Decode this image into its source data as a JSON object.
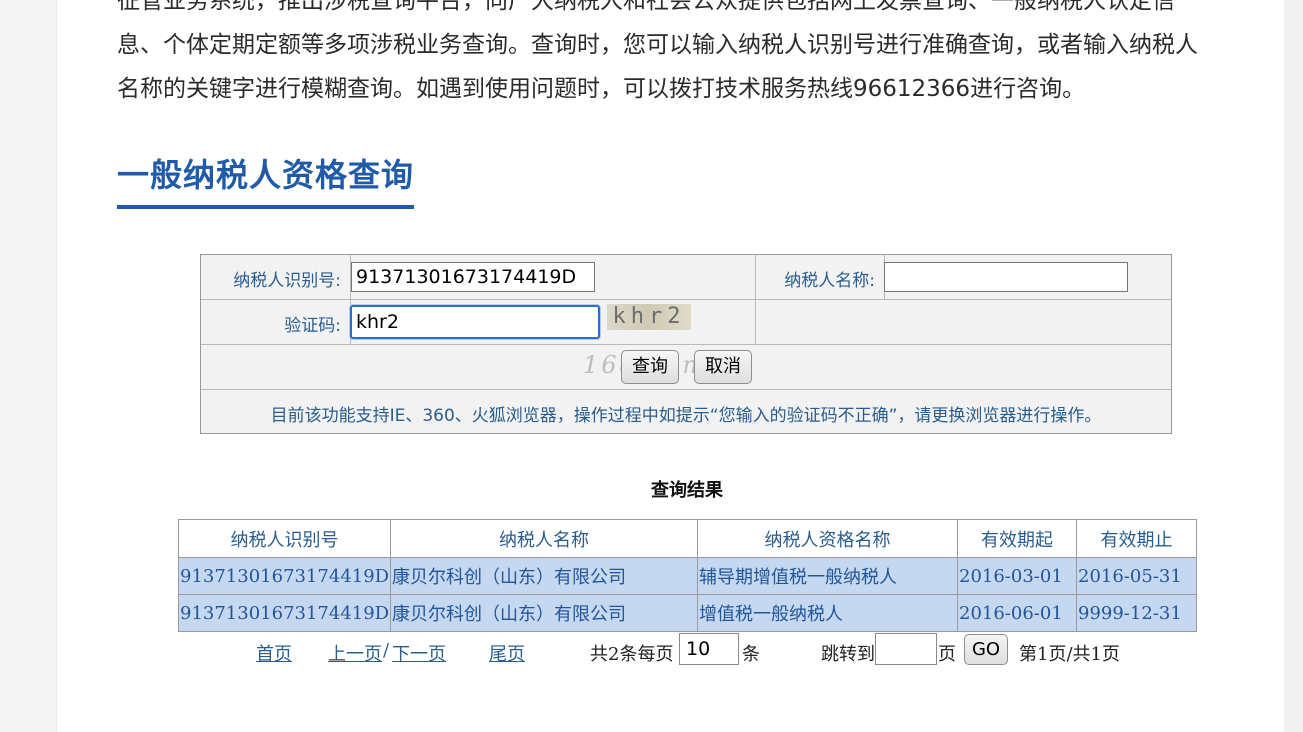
{
  "intro": {
    "line1": "征管业务系统，推出涉税查询平台，向广大纳税人和社会公众提供包括网上发票查询、一般纳税人认定信",
    "line2": "息、个体定期定额等多项涉税业务查询。查询时，您可以输入纳税人识别号进行准确查询，或者输入纳税人",
    "line3": "名称的关键字进行模糊查询。如遇到使用问题时，可以拨打技术服务热线96612366进行咨询。"
  },
  "section": {
    "title": "一般纳税人资格查询"
  },
  "form": {
    "taxpayer_id_label": "纳税人识别号:",
    "taxpayer_id_value": "91371301673174419D",
    "taxpayer_name_label": "纳税人名称:",
    "taxpayer_name_value": "",
    "captcha_label": "验证码:",
    "captcha_value": "khr2",
    "captcha_image_text": "khr2",
    "query_button": "查询",
    "cancel_button": "取消",
    "notice": "目前该功能支持IE、360、火狐浏览器，操作过程中如提示“您输入的验证码不正确”，请更换浏览器进行操作。",
    "watermark": "168.com"
  },
  "results": {
    "title": "查询结果",
    "columns": [
      "纳税人识别号",
      "纳税人名称",
      "纳税人资格名称",
      "有效期起",
      "有效期止"
    ],
    "rows": [
      [
        "91371301673174419D",
        "康贝尔科创（山东）有限公司",
        "辅导期增值税一般纳税人",
        "2016-03-01",
        "2016-05-31"
      ],
      [
        "91371301673174419D",
        "康贝尔科创（山东）有限公司",
        "增值税一般纳税人",
        "2016-06-01",
        "9999-12-31"
      ]
    ]
  },
  "pager": {
    "first": "首页",
    "prev": "上一页",
    "separator": "/",
    "next": "下一页",
    "last": "尾页",
    "total_prefix": "共2条每页",
    "per_page_value": "10",
    "per_page_suffix": "条",
    "jump_label": "跳转到",
    "jump_value": "",
    "page_suffix": "页",
    "go_button": "GO",
    "page_info": "第1页/共1页"
  }
}
